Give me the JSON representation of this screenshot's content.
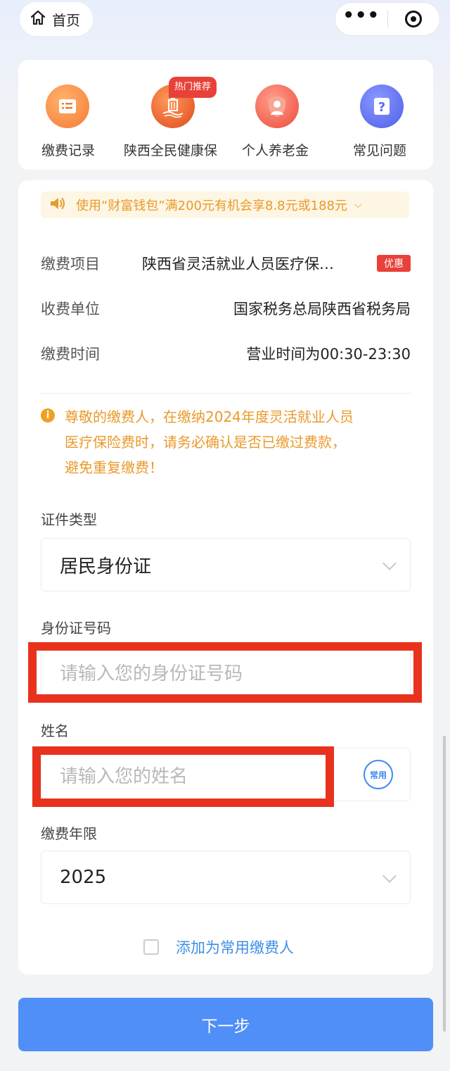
{
  "nav": {
    "home_label": "首页"
  },
  "quick_links": [
    {
      "label": "缴费记录",
      "icon": "list-doc-icon",
      "color": "#f57a36"
    },
    {
      "label": "陕西全民健康保",
      "icon": "building-icon",
      "color": "#ef5a2a",
      "badge": "热门推荐"
    },
    {
      "label": "个人养老金",
      "icon": "person-shield-icon",
      "color": "#f05a44"
    },
    {
      "label": "常见问题",
      "icon": "question-icon",
      "color": "#5c6cf0"
    }
  ],
  "notice": {
    "text": "使用“财富钱包”满200元有机会享8.8元或188元"
  },
  "info": {
    "item_label": "缴费项目",
    "item_value": "陕西省灵活就业人员医疗保…",
    "item_tag": "优惠",
    "unit_label": "收费单位",
    "unit_value": "国家税务总局陕西省税务局",
    "time_label": "缴费时间",
    "time_value": "营业时间为00:30-23:30"
  },
  "warning": {
    "line1": "尊敬的缴费人，在缴纳2024年度灵活就业人员",
    "line2": "医疗保险费时，请务必确认是否已缴过费款，",
    "line3": "避免重复缴费！"
  },
  "form": {
    "id_type_label": "证件类型",
    "id_type_value": "居民身份证",
    "id_number_label": "身份证号码",
    "id_number_placeholder": "请输入您的身份证号码",
    "name_label": "姓名",
    "name_placeholder": "请输入您的姓名",
    "common_btn": "常用",
    "year_label": "缴费年限",
    "year_value": "2025",
    "add_common_label": "添加为常用缴费人"
  },
  "next_label": "下一步",
  "colors": {
    "primary": "#4f8ff7",
    "warning": "#e99a2b",
    "tag_red": "#e8413a",
    "highlight_frame": "#e8321e"
  }
}
